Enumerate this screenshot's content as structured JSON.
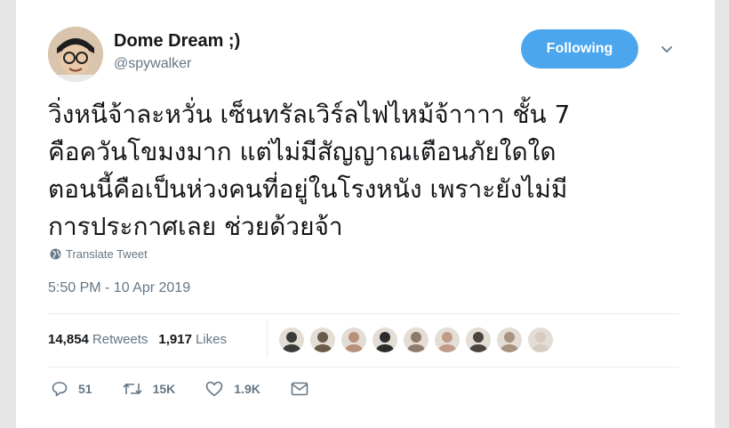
{
  "user": {
    "display_name": "Dome Dream ;)",
    "handle": "@spywalker",
    "avatar_icon": "avatar-person-glasses"
  },
  "follow_button": {
    "label": "Following",
    "color": "#4ba6ee"
  },
  "tweet": {
    "lines": [
      "วิ่งหนีจ้าละหวั่น เซ็นทรัลเวิร์ลไฟไหม้จ้าาาา ชั้น 7",
      "คือควันโขมงมาก แต่ไม่มีสัญญาณเตือนภัยใดใด",
      "ตอนนี้คือเป็นห่วงคนที่อยู่ในโรงหนัง เพราะยังไม่มี",
      "การประกาศเลย ช่วยด้วยจ้า"
    ],
    "translate_label": "Translate Tweet",
    "timestamp": "5:50 PM - 10 Apr 2019"
  },
  "stats": {
    "retweets_count": "14,854",
    "retweets_label": "Retweets",
    "likes_count": "1,917",
    "likes_label": "Likes"
  },
  "likers": [
    {
      "color": "#3b3b3b"
    },
    {
      "color": "#6a5a4a"
    },
    {
      "color": "#b88f7a"
    },
    {
      "color": "#2c2c2c"
    },
    {
      "color": "#8d7a6a"
    },
    {
      "color": "#c29a88"
    },
    {
      "color": "#4a4340"
    },
    {
      "color": "#a89280"
    },
    {
      "color": "#d8ccc0"
    }
  ],
  "actions": {
    "reply_count": "51",
    "retweet_count": "15K",
    "like_count": "1.9K"
  }
}
